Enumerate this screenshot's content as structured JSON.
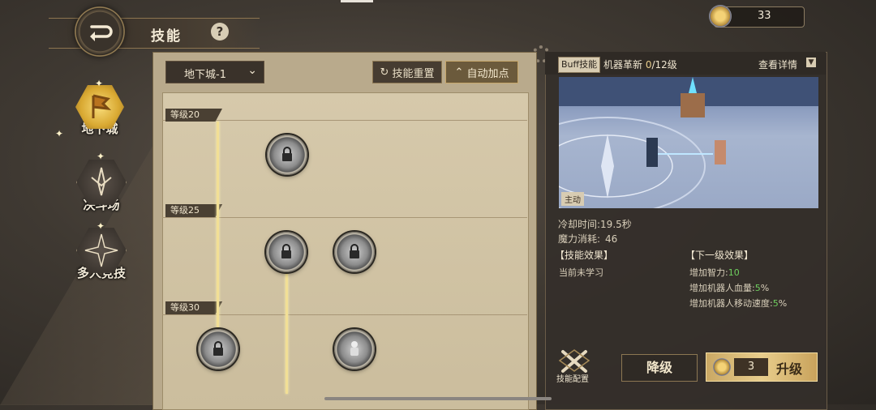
{
  "header": {
    "title": "技能",
    "help": "?",
    "currency_amount": "33"
  },
  "nav": {
    "items": [
      {
        "label": "地下城",
        "active": true
      },
      {
        "label": "决斗场",
        "active": false
      },
      {
        "label": "多人竞技",
        "active": false
      }
    ]
  },
  "toolbar": {
    "dungeon_select": "地下城-1",
    "reset_label": "技能重置",
    "auto_label": "自动加点"
  },
  "tree": {
    "levels": [
      "等级20",
      "等级25",
      "等级30"
    ]
  },
  "skill_panel": {
    "type_tag": "Buff技能",
    "name": "机器革新",
    "level_current": "0",
    "level_max": "/12级",
    "view_detail": "查看详情",
    "active_tag": "主动",
    "cooldown_label": "冷却时间:",
    "cooldown_value": "19.5秒",
    "mana_label": "魔力消耗:",
    "mana_value": "46",
    "current_title": "【技能效果】",
    "current_text": "当前未学习",
    "next_title": "【下一级效果】",
    "next_effects": [
      {
        "label": "增加智力:",
        "value": "10"
      },
      {
        "label": "增加机器人血量:",
        "value": "5",
        "unit": "%"
      },
      {
        "label": "增加机器人移动速度:",
        "value": "5",
        "unit": "%"
      }
    ]
  },
  "actions": {
    "config_label": "技能配置",
    "downgrade_label": "降级",
    "upgrade_cost": "3",
    "upgrade_label": "升级"
  },
  "colors": {
    "accent": "#e8cd8c",
    "green": "#6fcf5f",
    "panel": "#342f2a"
  }
}
